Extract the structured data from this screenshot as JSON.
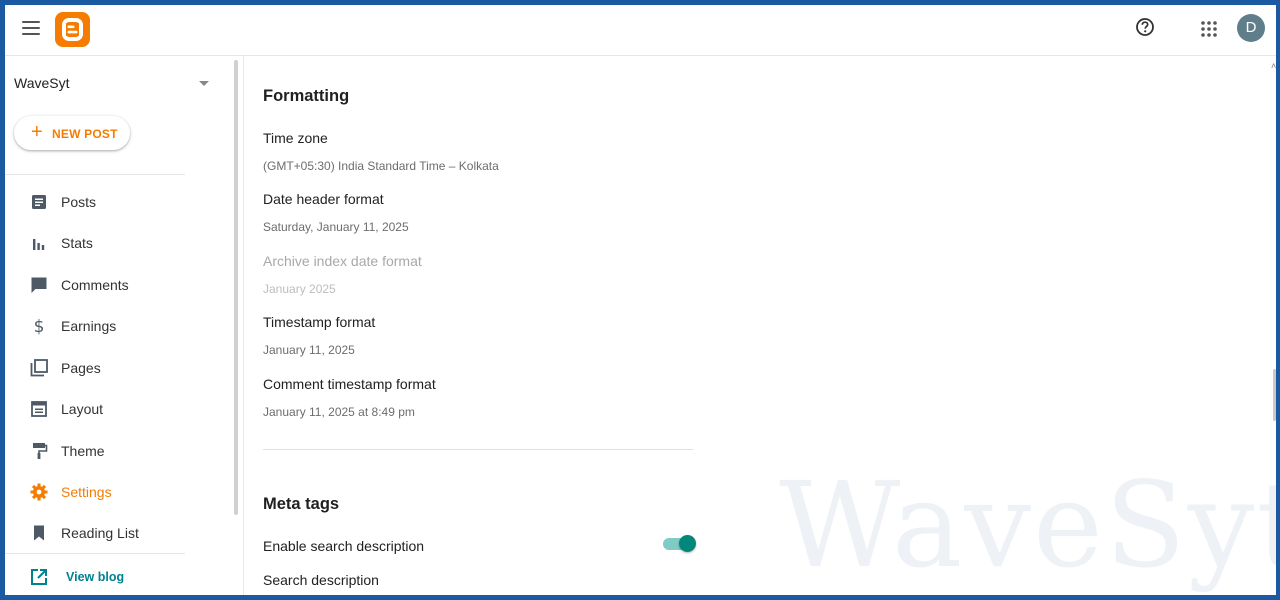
{
  "header": {
    "menu_icon": "hamburger-menu-icon",
    "logo_icon": "blogger-logo-icon",
    "help_icon": "help-circle-icon",
    "apps_icon": "apps-grid-icon",
    "avatar_initial": "D",
    "avatar_color": "#607d8b",
    "brand_color": "#f57c00"
  },
  "sidebar": {
    "blog_name": "WaveSyt",
    "new_post_label": "NEW POST",
    "items": [
      {
        "label": "Posts",
        "icon": "posts-icon"
      },
      {
        "label": "Stats",
        "icon": "stats-icon"
      },
      {
        "label": "Comments",
        "icon": "comments-icon"
      },
      {
        "label": "Earnings",
        "icon": "dollar-icon"
      },
      {
        "label": "Pages",
        "icon": "pages-icon"
      },
      {
        "label": "Layout",
        "icon": "layout-icon"
      },
      {
        "label": "Theme",
        "icon": "paint-roller-icon"
      },
      {
        "label": "Settings",
        "icon": "gear-icon",
        "active": true
      },
      {
        "label": "Reading List",
        "icon": "bookmark-icon"
      }
    ],
    "view_blog_label": "View blog",
    "active_color": "#f57c00",
    "link_color": "#00838f"
  },
  "main": {
    "formatting": {
      "title": "Formatting",
      "settings": [
        {
          "label": "Time zone",
          "value": "(GMT+05:30) India Standard Time – Kolkata"
        },
        {
          "label": "Date header format",
          "value": "Saturday, January 11, 2025"
        },
        {
          "label": "Archive index date format",
          "value": "January 2025",
          "disabled": true
        },
        {
          "label": "Timestamp format",
          "value": "January 11, 2025"
        },
        {
          "label": "Comment timestamp format",
          "value": "January 11, 2025 at 8:49 pm"
        }
      ]
    },
    "meta_tags": {
      "title": "Meta tags",
      "enable_search_description": {
        "label": "Enable search description",
        "enabled": true
      },
      "search_description_label": "Search description"
    },
    "watermark": "WaveSyt",
    "toggle_color": "#00897b"
  }
}
